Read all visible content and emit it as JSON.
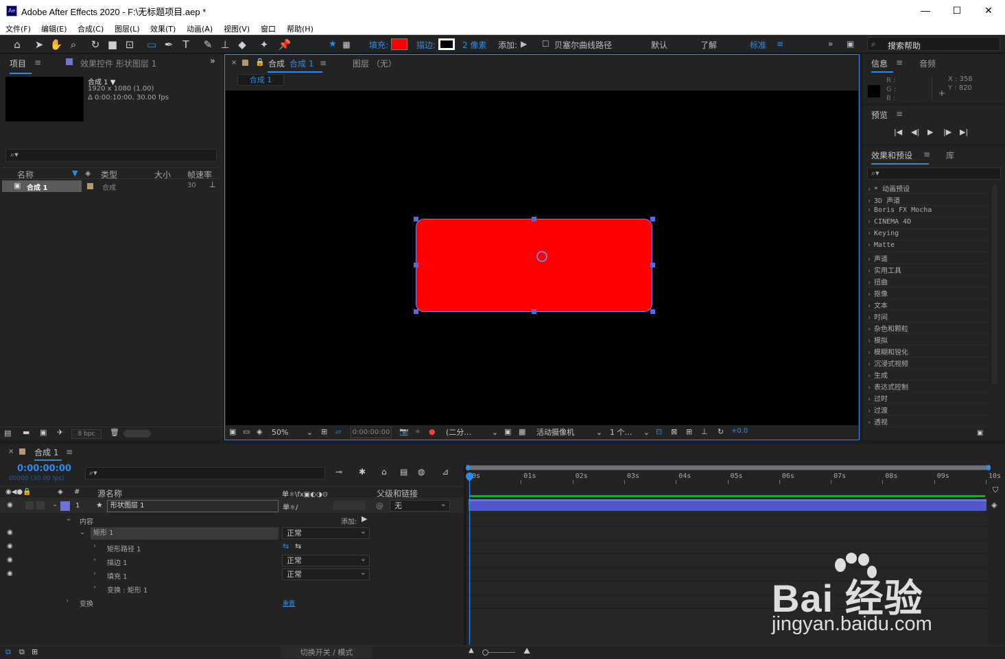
{
  "window": {
    "app_icon": "Ae",
    "title": "Adobe After Effects 2020 - F:\\无标题项目.aep *",
    "minimize": "—",
    "maximize": "☐",
    "close": "✕"
  },
  "menu": [
    "文件(F)",
    "编辑(E)",
    "合成(C)",
    "图层(L)",
    "效果(T)",
    "动画(A)",
    "视图(V)",
    "窗口",
    "帮助(H)"
  ],
  "toolbar": {
    "fill_label": "填充:",
    "stroke_label": "描边:",
    "stroke_width": "2 像素",
    "add_label": "添加:",
    "bezier_label": "贝塞尔曲线路径",
    "workspace_default": "默认",
    "workspace_learn": "了解",
    "workspace_standard": "标准",
    "search_help": "搜索帮助",
    "fill_color": "#ff0000"
  },
  "project": {
    "tab": "项目",
    "effects_tab": "效果控件 形状图层 1",
    "comp_name": "合成 1 ▼",
    "comp_res": "1920 x 1080 (1.00)",
    "comp_dur": "Δ 0:00:10:00, 30.00 fps",
    "search_placeholder": "",
    "columns": [
      "名称",
      "类型",
      "大小",
      "帧速率"
    ],
    "rows": [
      {
        "name": "合成 1",
        "type": "合成",
        "size": "",
        "fps": "30"
      }
    ],
    "bpc": "8 bpc"
  },
  "composition": {
    "tab_label": "合成",
    "tab_active": "合成 1",
    "layer_tab": "图层 （无）",
    "breadcrumb": "合成 1",
    "zoom": "50%",
    "time": "0:00:00:00",
    "resolution": "(二分…",
    "camera": "活动摄像机",
    "views": "1 个…",
    "exposure": "+0.0",
    "rect_color": "#ff0000"
  },
  "info": {
    "tab": "信息",
    "audio_tab": "音频",
    "r": "R :",
    "g": "G :",
    "b": "B :",
    "x": "X : 358",
    "y": "Y : 820"
  },
  "preview": {
    "tab": "预览"
  },
  "effects": {
    "tab": "效果和预设",
    "lib_tab": "库",
    "items": [
      "* 动画预设",
      "3D 声道",
      "Boris FX Mocha",
      "CINEMA 4D",
      "Keying",
      "Matte",
      "声道",
      "实用工具",
      "扭曲",
      "抠像",
      "文本",
      "时间",
      "杂色和颗粒",
      "模拟",
      "模糊和锐化",
      "沉浸式视频",
      "生成",
      "表达式控制",
      "过时",
      "过渡",
      "透视"
    ]
  },
  "timeline": {
    "tab": "合成 1",
    "timecode": "0:00:00:00",
    "frames": "00000 (30.00 fps)",
    "col_source": "源名称",
    "col_parent": "父级和链接",
    "layer_num": "1",
    "layer_name": "形状图层 1",
    "parent_value": "无",
    "contents": "内容",
    "add": "添加:",
    "rect": "矩形 1",
    "blend_rect": "正常",
    "rect_path": "矩形路径 1",
    "stroke": "描边 1",
    "blend_stroke": "正常",
    "fill": "填充 1",
    "blend_fill": "正常",
    "transform_rect": "变换 : 矩形 1",
    "transform": "变换",
    "reset": "重置",
    "toggle": "切换开关 / 模式",
    "ruler": [
      "0s",
      "01s",
      "02s",
      "03s",
      "04s",
      "05s",
      "06s",
      "07s",
      "08s",
      "09s",
      "10s"
    ]
  },
  "watermark": {
    "brand": "Bai 经验",
    "url": "jingyan.baidu.com"
  }
}
